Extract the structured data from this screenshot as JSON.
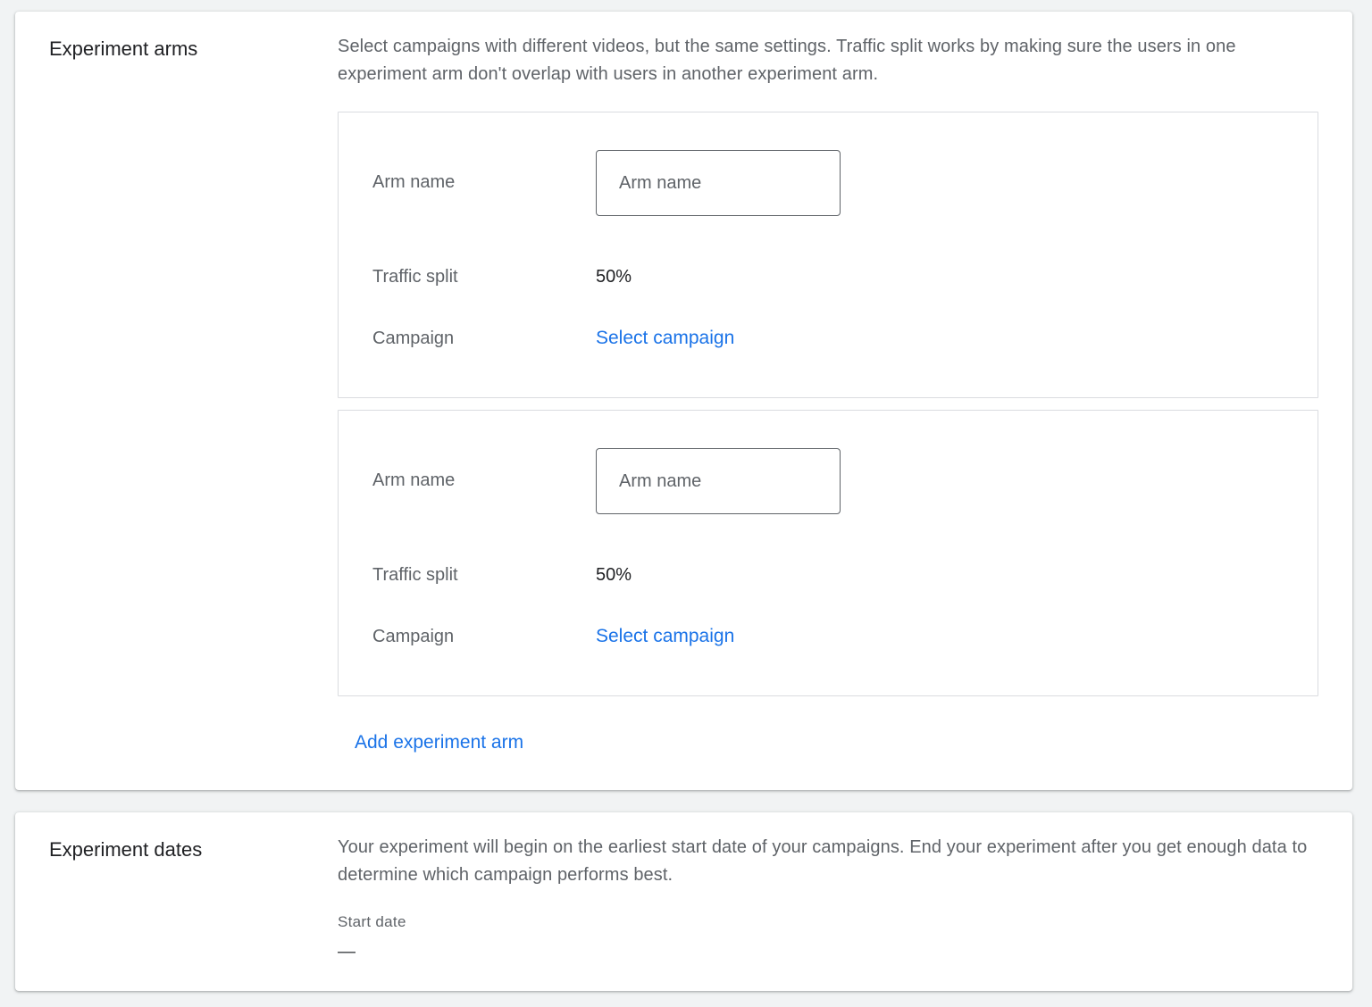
{
  "arms_section": {
    "title": "Experiment arms",
    "description": "Select campaigns with different videos, but the same settings. Traffic split works by making sure the users in one experiment arm don't overlap with users in another experiment arm.",
    "arms": [
      {
        "name_label": "Arm name",
        "name_placeholder": "Arm name",
        "name_value": "",
        "split_label": "Traffic split",
        "split_value": "50%",
        "campaign_label": "Campaign",
        "campaign_link": "Select campaign"
      },
      {
        "name_label": "Arm name",
        "name_placeholder": "Arm name",
        "name_value": "",
        "split_label": "Traffic split",
        "split_value": "50%",
        "campaign_label": "Campaign",
        "campaign_link": "Select campaign"
      }
    ],
    "add_arm_label": "Add experiment arm"
  },
  "dates_section": {
    "title": "Experiment dates",
    "description": "Your experiment will begin on the earliest start date of your campaigns. End your experiment after you get enough data to determine which campaign performs best.",
    "start_date_label": "Start date",
    "start_date_value": "—"
  },
  "colors": {
    "background": "#f1f3f4",
    "card": "#ffffff",
    "link": "#1a73e8",
    "text_primary": "#202124",
    "text_secondary": "#5f6368",
    "border": "#dadce0"
  }
}
